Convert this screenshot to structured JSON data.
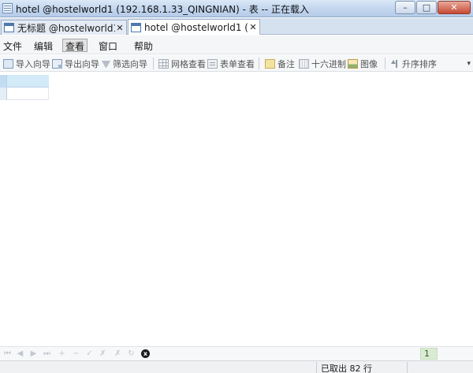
{
  "window": {
    "title": "hotel @hostelworld1 (192.168.1.33_QINGNIAN) - 表 -- 正在载入",
    "controls": {
      "minimize": "–",
      "maximize": "□",
      "close": "✕"
    }
  },
  "tabs": [
    {
      "label": "无标题 @hostelworld1 (...",
      "close": "✕",
      "icon": "query-icon",
      "active": false
    },
    {
      "label": "hotel @hostelworld1 (19...",
      "close": "✕",
      "icon": "table-icon",
      "active": true
    }
  ],
  "menu": {
    "file": "文件",
    "edit": "编辑",
    "view": "查看",
    "window": "窗口",
    "help": "帮助"
  },
  "toolbar": {
    "import_wizard": "导入向导",
    "export_wizard": "导出向导",
    "filter_wizard": "筛选向导",
    "grid_view": "网格查看",
    "form_view": "表单查看",
    "memo": "备注",
    "hex": "十六进制",
    "image": "图像",
    "sort_asc": "升序排序",
    "overflow": "▾"
  },
  "navigator": {
    "first": "⏮",
    "prev": "◀",
    "next": "▶",
    "last": "⏭",
    "add": "+",
    "delete": "−",
    "apply": "✓",
    "cancel": "✗",
    "refresh": "↻",
    "stop": "x",
    "page": "1"
  },
  "status": {
    "rows_fetched": "已取出 82 行"
  },
  "colors": {
    "titlebar": "#c6d9f0",
    "selected_row": "#cfe6f5",
    "page_box": "#d9ecd3"
  }
}
